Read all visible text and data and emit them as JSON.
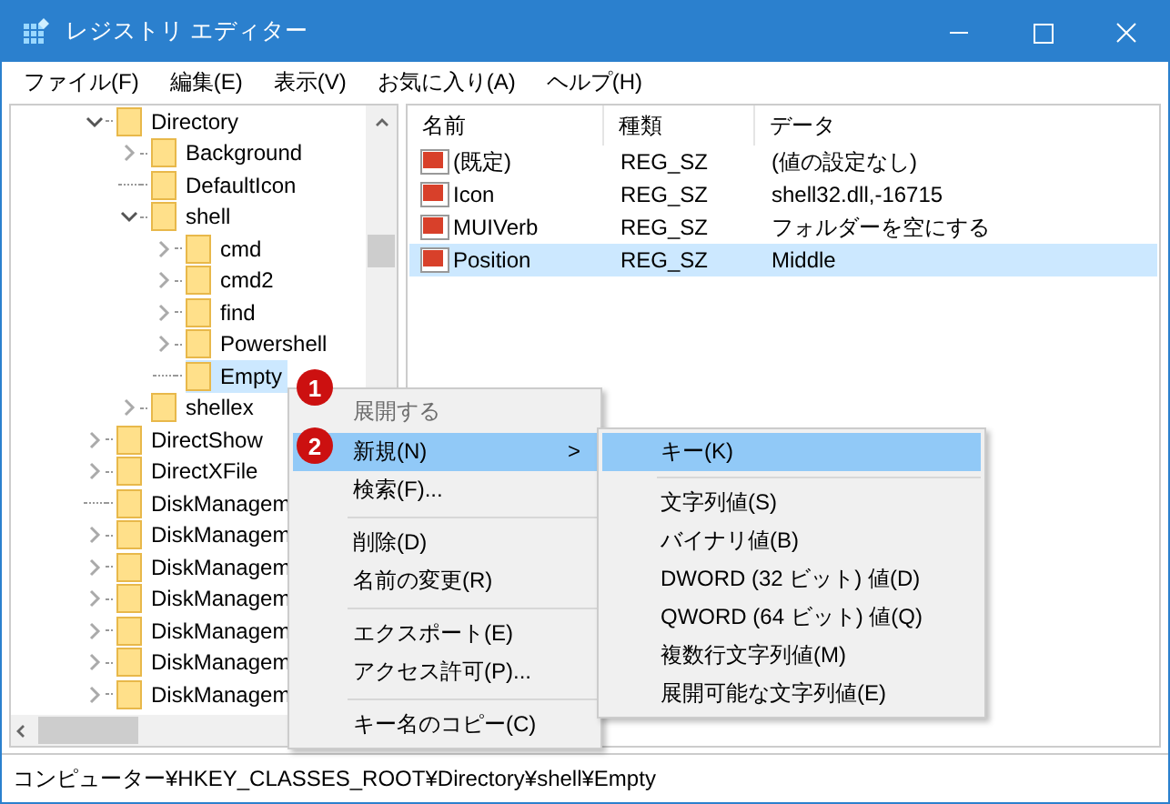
{
  "window": {
    "title": "レジストリ エディター"
  },
  "menu_bar": [
    "ファイル(F)",
    "編集(E)",
    "表示(V)",
    "お気に入り(A)",
    "ヘルプ(H)"
  ],
  "tree": [
    {
      "label": "Directory",
      "expandable": true,
      "expanded": true,
      "selected": false,
      "children": [
        {
          "label": "Background",
          "expandable": true,
          "expanded": false,
          "selected": false
        },
        {
          "label": "DefaultIcon",
          "expandable": false,
          "selected": false
        },
        {
          "label": "shell",
          "expandable": true,
          "expanded": true,
          "selected": false,
          "children": [
            {
              "label": "cmd",
              "expandable": true,
              "expanded": false,
              "selected": false
            },
            {
              "label": "cmd2",
              "expandable": true,
              "expanded": false,
              "selected": false
            },
            {
              "label": "find",
              "expandable": true,
              "expanded": false,
              "selected": false
            },
            {
              "label": "Powershell",
              "expandable": true,
              "expanded": false,
              "selected": false
            },
            {
              "label": "Empty",
              "expandable": false,
              "selected": true
            }
          ]
        },
        {
          "label": "shellex",
          "expandable": true,
          "expanded": false,
          "selected": false
        }
      ]
    },
    {
      "label": "DirectShow",
      "expandable": true,
      "expanded": false,
      "selected": false
    },
    {
      "label": "DirectXFile",
      "expandable": true,
      "expanded": false,
      "selected": false
    },
    {
      "label": "DiskManagem",
      "expandable": false,
      "selected": false
    },
    {
      "label": "DiskManagem",
      "expandable": true,
      "expanded": false,
      "selected": false
    },
    {
      "label": "DiskManagem",
      "expandable": true,
      "expanded": false,
      "selected": false
    },
    {
      "label": "DiskManagem",
      "expandable": true,
      "expanded": false,
      "selected": false
    },
    {
      "label": "DiskManagem",
      "expandable": true,
      "expanded": false,
      "selected": false
    },
    {
      "label": "DiskManagem",
      "expandable": true,
      "expanded": false,
      "selected": false
    },
    {
      "label": "DiskManagem",
      "expandable": true,
      "expanded": false,
      "selected": false
    }
  ],
  "values": {
    "columns": [
      "名前",
      "種類",
      "データ"
    ],
    "rows": [
      {
        "name": "(既定)",
        "type": "REG_SZ",
        "data": "(値の設定なし)",
        "selected": false
      },
      {
        "name": "Icon",
        "type": "REG_SZ",
        "data": "shell32.dll,-16715",
        "selected": false
      },
      {
        "name": "MUIVerb",
        "type": "REG_SZ",
        "data": "フォルダーを空にする",
        "selected": false
      },
      {
        "name": "Position",
        "type": "REG_SZ",
        "data": "Middle",
        "selected": true
      }
    ]
  },
  "context_menu": [
    {
      "kind": "item",
      "label": "展開する",
      "disabled": true,
      "selected": false
    },
    {
      "kind": "item",
      "label": "新規(N)",
      "disabled": false,
      "selected": true,
      "arrow": ">"
    },
    {
      "kind": "item",
      "label": "検索(F)...",
      "disabled": false,
      "selected": false
    },
    {
      "kind": "separator"
    },
    {
      "kind": "item",
      "label": "削除(D)",
      "disabled": false,
      "selected": false
    },
    {
      "kind": "item",
      "label": "名前の変更(R)",
      "disabled": false,
      "selected": false
    },
    {
      "kind": "separator"
    },
    {
      "kind": "item",
      "label": "エクスポート(E)",
      "disabled": false,
      "selected": false
    },
    {
      "kind": "item",
      "label": "アクセス許可(P)...",
      "disabled": false,
      "selected": false
    },
    {
      "kind": "separator"
    },
    {
      "kind": "item",
      "label": "キー名のコピー(C)",
      "disabled": false,
      "selected": false
    }
  ],
  "submenu": [
    {
      "kind": "item",
      "label": "キー(K)",
      "selected": true
    },
    {
      "kind": "separator"
    },
    {
      "kind": "item",
      "label": "文字列値(S)",
      "selected": false
    },
    {
      "kind": "item",
      "label": "バイナリ値(B)",
      "selected": false
    },
    {
      "kind": "item",
      "label": "DWORD (32 ビット) 値(D)",
      "selected": false
    },
    {
      "kind": "item",
      "label": "QWORD (64 ビット) 値(Q)",
      "selected": false
    },
    {
      "kind": "item",
      "label": "複数行文字列値(M)",
      "selected": false
    },
    {
      "kind": "item",
      "label": "展開可能な文字列値(E)",
      "selected": false
    }
  ],
  "callouts": [
    "1",
    "2"
  ],
  "status_bar": "コンピューター¥HKEY_CLASSES_ROOT¥Directory¥shell¥Empty"
}
